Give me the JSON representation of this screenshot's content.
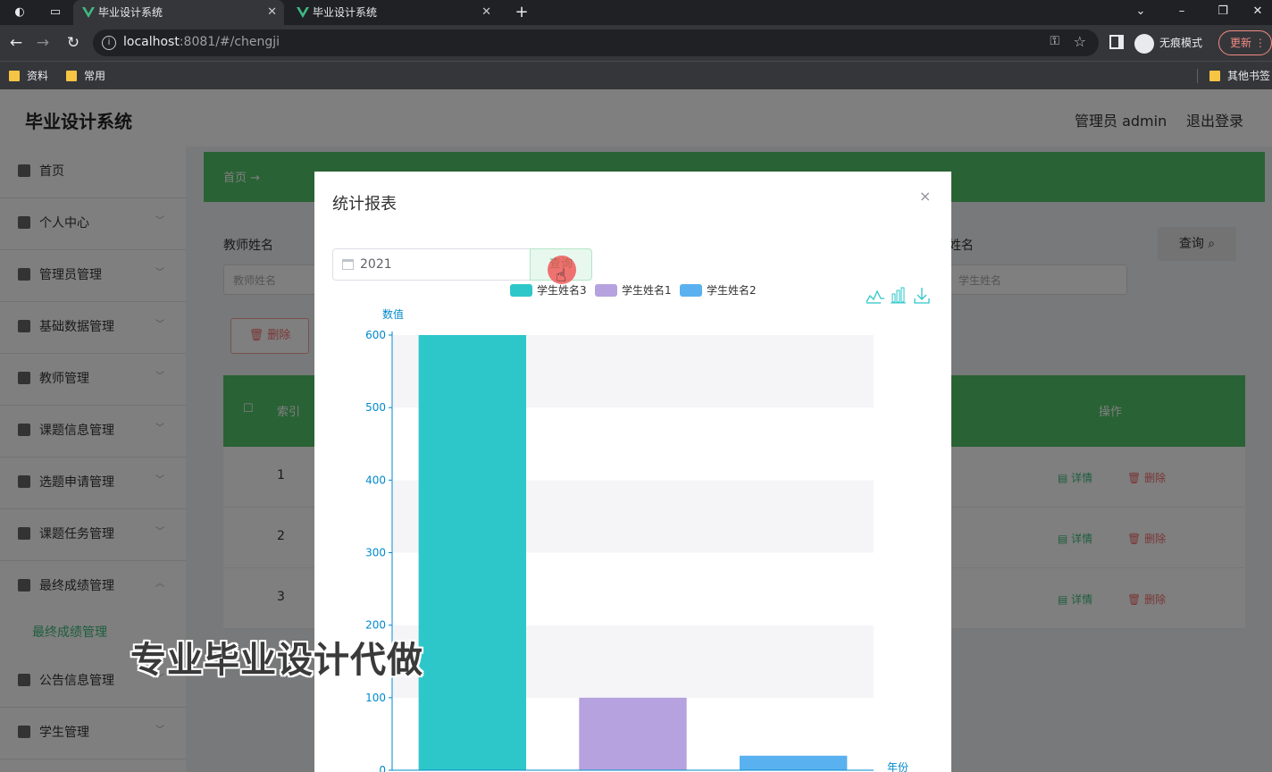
{
  "browser": {
    "tabs": [
      {
        "title": "毕业设计系统",
        "active": true
      },
      {
        "title": "毕业设计系统",
        "active": false
      }
    ],
    "url_host": "localhost",
    "url_rest": ":8081/#/chengji",
    "incognito_label": "无痕模式",
    "update_label": "更新",
    "bookmarks": [
      "资料",
      "常用"
    ],
    "other_bookmarks": "其他书签"
  },
  "app": {
    "title": "毕业设计系统",
    "admin_label": "管理员 admin",
    "logout_label": "退出登录",
    "menu": [
      {
        "label": "首页",
        "icon": "home-icon"
      },
      {
        "label": "个人中心",
        "icon": "user-icon"
      },
      {
        "label": "管理员管理",
        "icon": "bar-icon"
      },
      {
        "label": "基础数据管理",
        "icon": "send-icon"
      },
      {
        "label": "教师管理",
        "icon": "book-icon"
      },
      {
        "label": "课题信息管理",
        "icon": "chat-icon"
      },
      {
        "label": "选题申请管理",
        "icon": "clock-icon"
      },
      {
        "label": "课题任务管理",
        "icon": "compass-icon"
      },
      {
        "label": "最终成绩管理",
        "icon": "card-icon"
      },
      {
        "label": "公告信息管理",
        "icon": "news-icon"
      },
      {
        "label": "学生管理",
        "icon": "doc-icon"
      }
    ],
    "submenu_label": "最终成绩管理",
    "breadcrumb_home": "首页",
    "search": {
      "teacher_label": "教师姓名",
      "teacher_placeholder": "教师姓名",
      "student_label": "学生姓名",
      "student_placeholder": "学生姓名",
      "button": "查询"
    },
    "batch_delete": "删除",
    "table": {
      "header_index": "索引",
      "header_ops": "操作",
      "rows": [
        "1",
        "2",
        "3"
      ],
      "detail": "详情",
      "delete": "删除"
    }
  },
  "modal": {
    "title": "统计报表",
    "close": "×",
    "year_value": "2021",
    "query_label": "查询"
  },
  "chart_data": {
    "type": "bar",
    "categories": [
      "学生姓名3",
      "学生姓名1",
      "学生姓名2"
    ],
    "series": [
      {
        "name": "学生姓名3",
        "value": 600,
        "color": "#2ec7c9"
      },
      {
        "name": "学生姓名1",
        "value": 100,
        "color": "#b6a2de"
      },
      {
        "name": "学生姓名2",
        "value": 20,
        "color": "#5ab1ef"
      }
    ],
    "ylabel": "数值",
    "xlabel": "年份",
    "ylim": [
      0,
      600
    ],
    "yticks": [
      0,
      100,
      200,
      300,
      400,
      500,
      600
    ],
    "legend_position": "top",
    "toolbox": [
      "line-icon",
      "bar-icon",
      "download-icon"
    ],
    "axis_color": "#008acd"
  },
  "watermark": "专业毕业设计代做"
}
